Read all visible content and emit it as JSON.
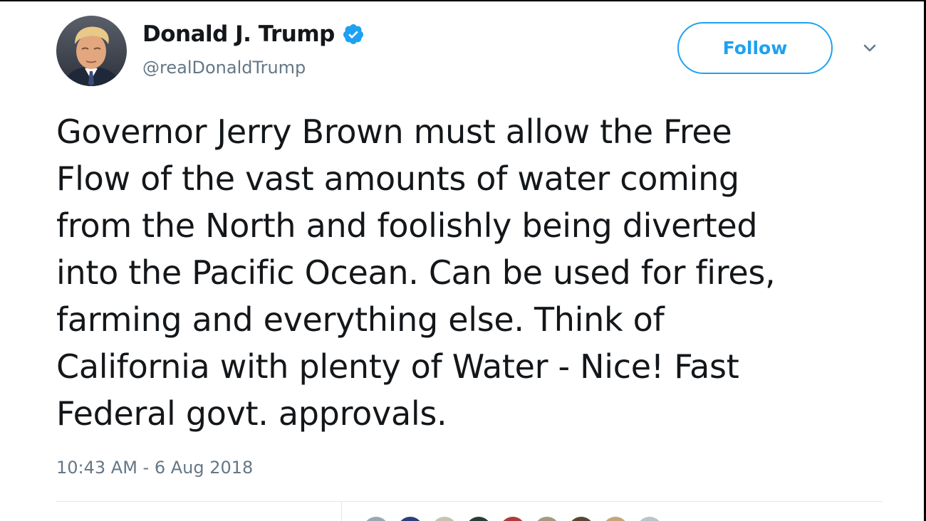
{
  "tweet": {
    "author_name": "Donald J. Trump",
    "handle": "@realDonaldTrump",
    "verified": true,
    "follow_label": "Follow",
    "text": "Governor Jerry Brown must allow the Free\nFlow of the vast amounts of water coming\nfrom the North and foolishly being diverted\ninto the Pacific Ocean. Can be used for fires,\nfarming and everything else. Think of\nCalifornia with plenty of Water - Nice! Fast\nFederal govt. approvals.",
    "timestamp": "10:43 AM - 6 Aug 2018"
  },
  "icons": {
    "verified": "verified-badge-icon",
    "more": "chevron-down-icon"
  },
  "colors": {
    "accent": "#1da1f2",
    "text_primary": "#14171a",
    "text_secondary": "#657786",
    "divider": "#e1e8ed"
  },
  "likers": [
    {
      "color": "#9aa7b3"
    },
    {
      "color": "#2b3f78"
    },
    {
      "color": "#c9c2b5"
    },
    {
      "color": "#2c3a3a"
    },
    {
      "color": "#b03a3a"
    },
    {
      "color": "#a89880"
    },
    {
      "color": "#5a4535"
    },
    {
      "color": "#c8a27a"
    },
    {
      "color": "#b9c4cc"
    }
  ]
}
